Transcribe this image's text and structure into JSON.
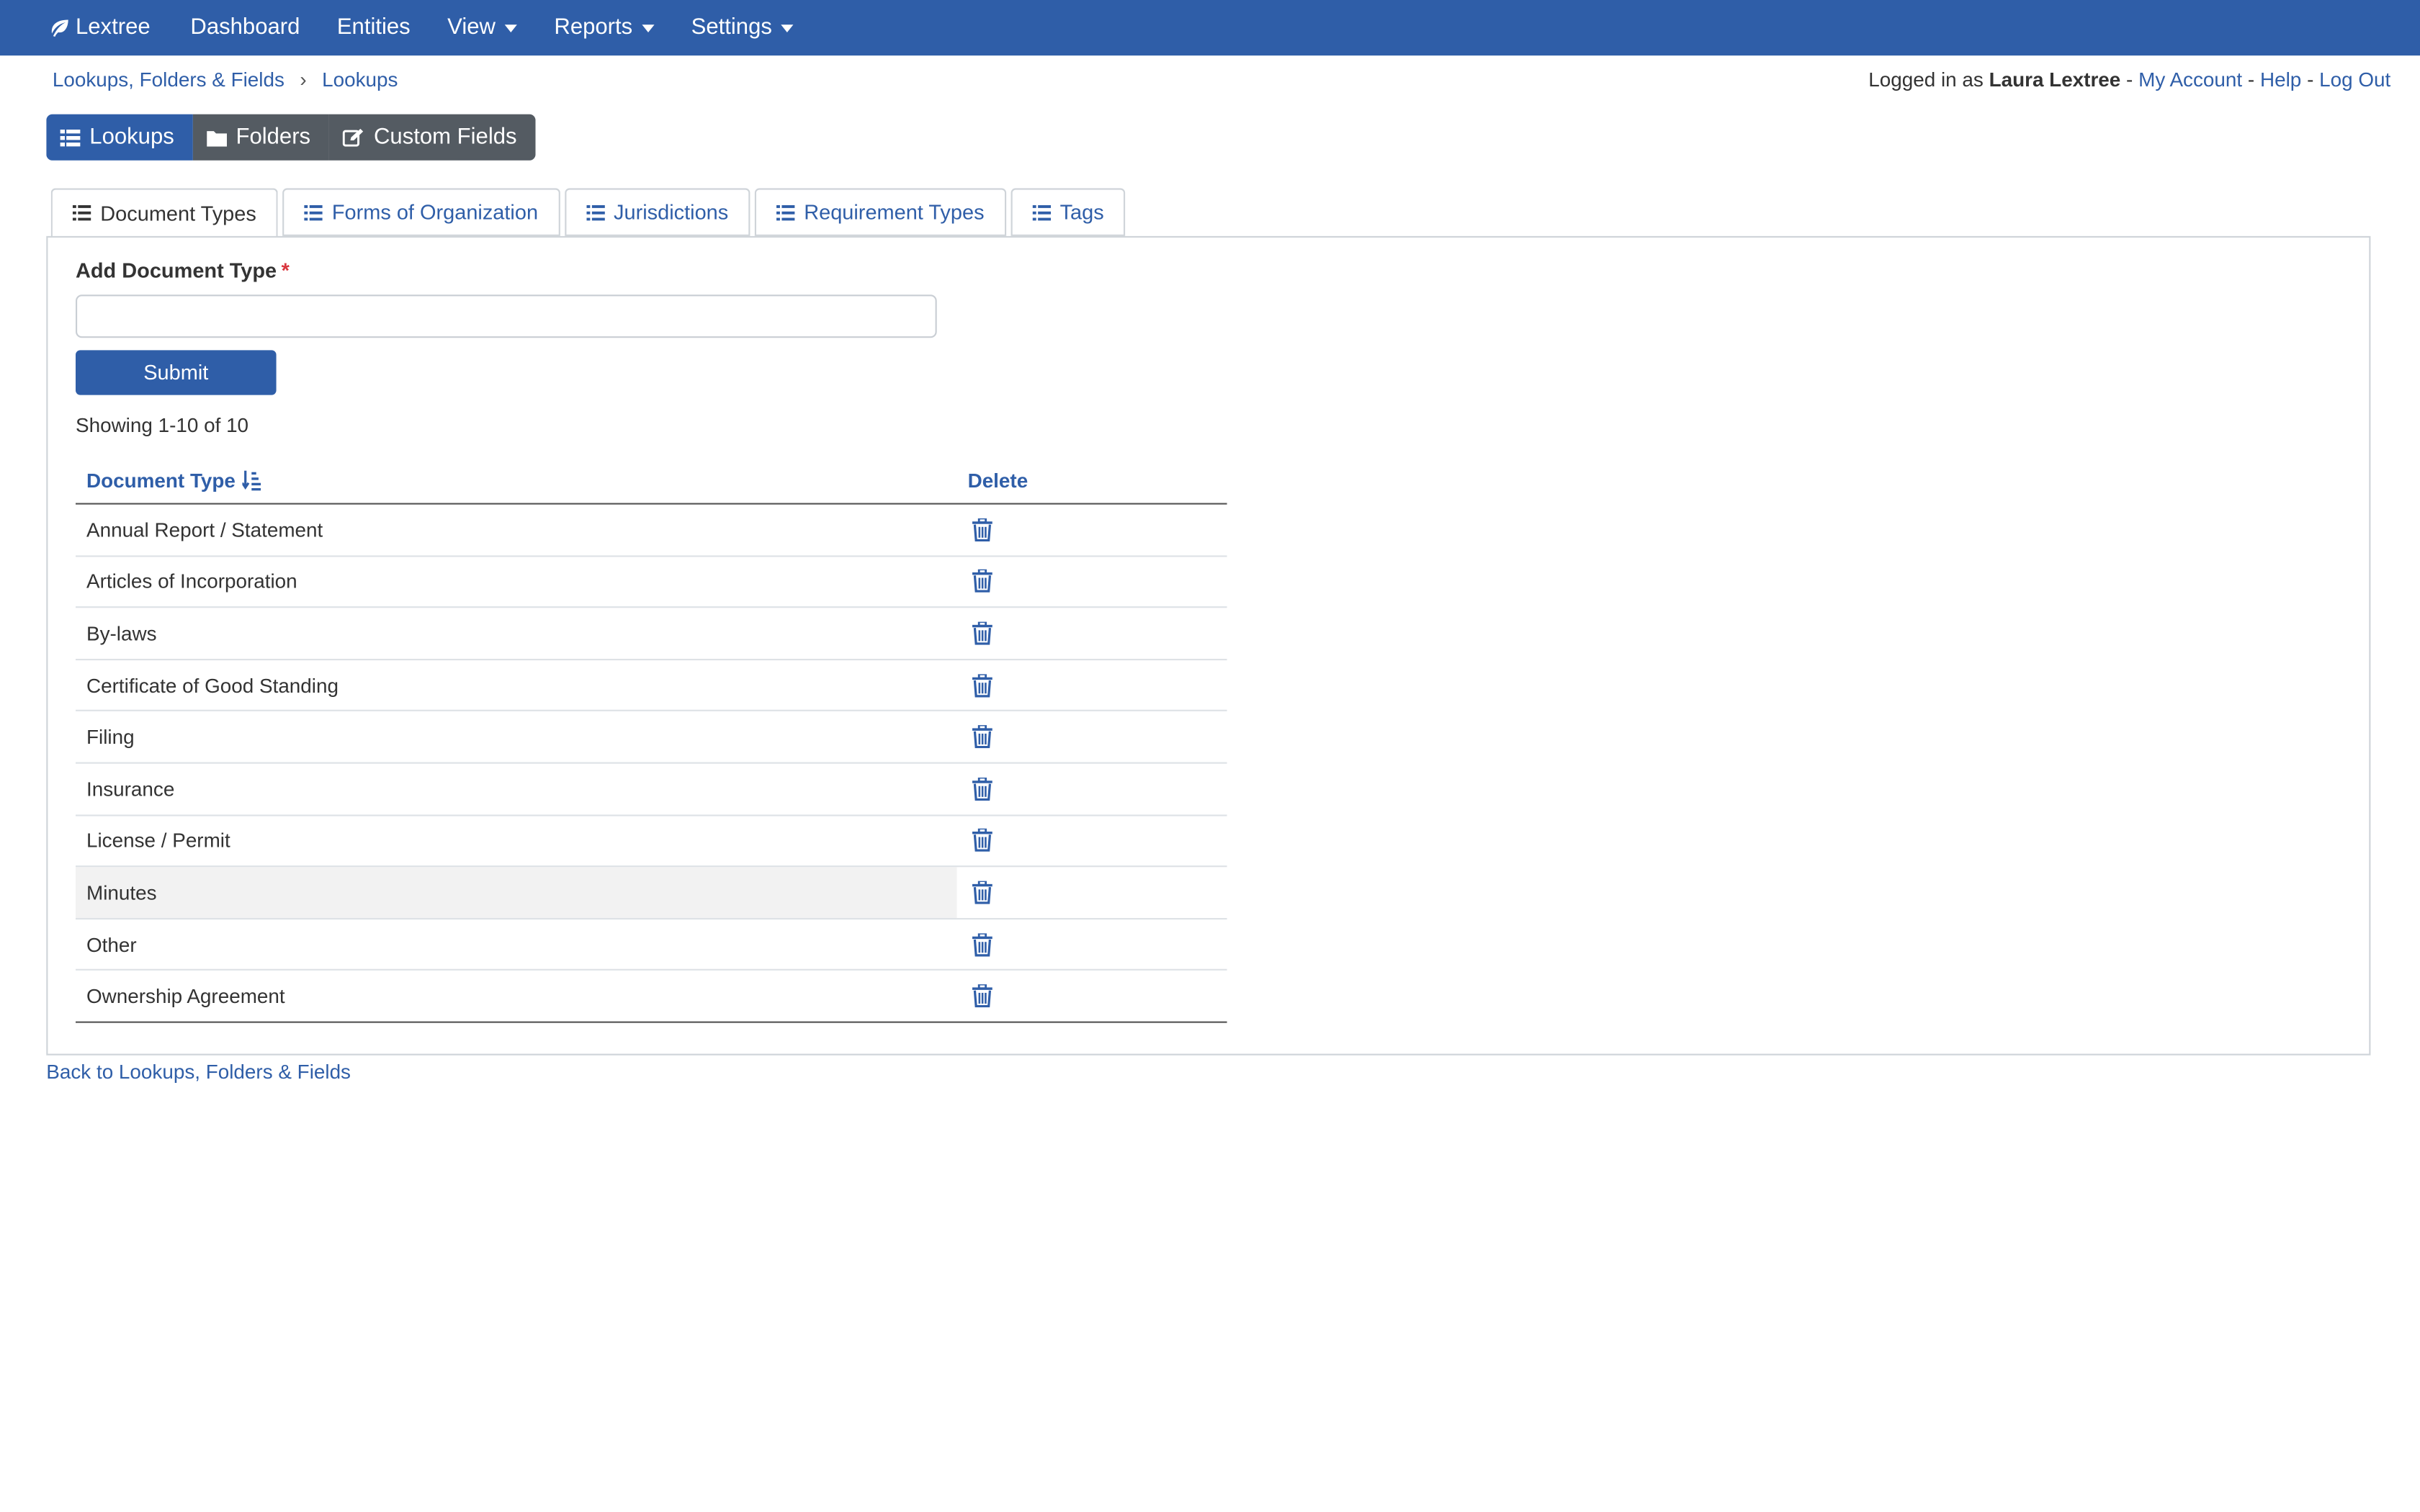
{
  "colors": {
    "navbar": "#2f5ea8",
    "link": "#2f5ea8",
    "secondary_button": "#545b62",
    "required": "#d9363e"
  },
  "navbar": {
    "brand": "Lextree",
    "items": [
      {
        "label": "Dashboard",
        "dropdown": false
      },
      {
        "label": "Entities",
        "dropdown": false
      },
      {
        "label": "View",
        "dropdown": true
      },
      {
        "label": "Reports",
        "dropdown": true
      },
      {
        "label": "Settings",
        "dropdown": true
      }
    ]
  },
  "breadcrumb": {
    "items": [
      "Lookups, Folders & Fields",
      "Lookups"
    ],
    "separator": "›"
  },
  "account": {
    "prefix": "Logged in as",
    "user": "Laura Lextree",
    "links": [
      "My Account",
      "Help",
      "Log Out"
    ],
    "separator": "-"
  },
  "segment": {
    "buttons": [
      {
        "label": "Lookups",
        "icon": "list-icon",
        "active": true
      },
      {
        "label": "Folders",
        "icon": "folder-icon",
        "active": false
      },
      {
        "label": "Custom Fields",
        "icon": "edit-icon",
        "active": false
      }
    ]
  },
  "tabs": [
    {
      "label": "Document Types",
      "active": true
    },
    {
      "label": "Forms of Organization",
      "active": false
    },
    {
      "label": "Jurisdictions",
      "active": false
    },
    {
      "label": "Requirement Types",
      "active": false
    },
    {
      "label": "Tags",
      "active": false
    }
  ],
  "form": {
    "label": "Add Document Type",
    "required_mark": "*",
    "value": "",
    "placeholder": "",
    "submit_label": "Submit"
  },
  "showing": "Showing 1-10 of 10",
  "table": {
    "headers": {
      "type": "Document Type",
      "delete": "Delete"
    },
    "rows": [
      "Annual Report / Statement",
      "Articles of Incorporation",
      "By-laws",
      "Certificate of Good Standing",
      "Filing",
      "Insurance",
      "License / Permit",
      "Minutes",
      "Other",
      "Ownership Agreement"
    ],
    "highlighted_row": "Minutes"
  },
  "back_link": "Back to Lookups, Folders & Fields"
}
